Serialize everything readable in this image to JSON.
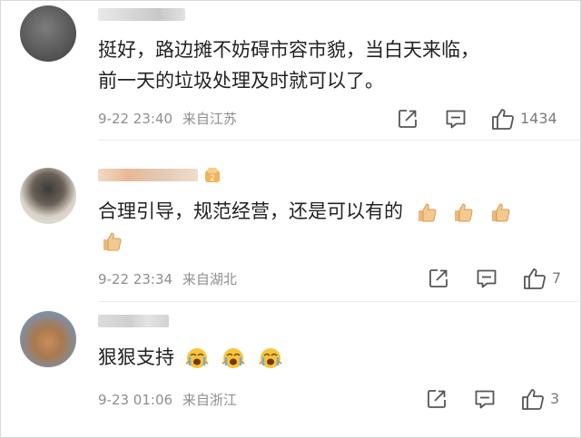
{
  "comments": [
    {
      "text_lines": [
        "挺好，路边摊不妨碍市容市貌，当白天来临，",
        "前一天的垃圾处理及时就可以了。"
      ],
      "timestamp": "9-22 23:40",
      "location": "来自江苏",
      "like_count": "1434",
      "icons": [
        "share-icon",
        "comment-icon",
        "thumbs-up-icon"
      ]
    },
    {
      "text": "合理引导，规范经营，还是可以有的",
      "emojis": [
        "thumbs-up-emoji",
        "thumbs-up-emoji",
        "thumbs-up-emoji",
        "thumbs-up-emoji"
      ],
      "timestamp": "9-22 23:34",
      "location": "来自湖北",
      "like_count": "7",
      "icons": [
        "share-icon",
        "comment-icon",
        "thumbs-up-icon"
      ]
    },
    {
      "text": "狠狠支持",
      "emojis": [
        "crying-face-emoji",
        "crying-face-emoji",
        "crying-face-emoji"
      ],
      "timestamp": "9-23 01:06",
      "location": "来自浙江",
      "like_count": "3",
      "icons": [
        "share-icon",
        "comment-icon",
        "thumbs-up-icon"
      ]
    }
  ],
  "colors": {
    "text": "#222222",
    "meta": "#8e8e8e",
    "icon": "#555555",
    "divider": "#ececec"
  }
}
